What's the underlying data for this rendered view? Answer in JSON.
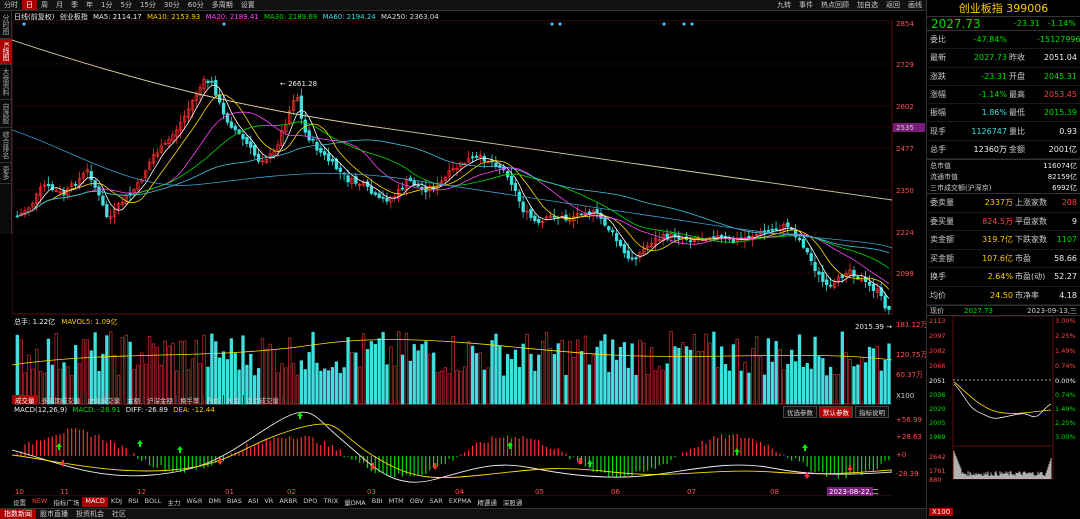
{
  "toolbar": {
    "items": [
      "分时",
      "日",
      "周",
      "月",
      "季",
      "年",
      "1分",
      "5分",
      "15分",
      "30分",
      "60分",
      "多周期",
      "设置"
    ],
    "active_index": 1,
    "right_items": [
      "九转",
      "事件",
      "热点回顾",
      "加自选",
      "返回",
      "画线"
    ]
  },
  "left_tabs": [
    "分时图",
    "K线图",
    "大盘资料",
    "自选股",
    "综合排名",
    "更多"
  ],
  "left_tabs_active": 1,
  "kline_legend": {
    "label": "日线(前复权)",
    "name": "创业板指",
    "ma5": "MA5: 2114.17",
    "ma10": "MA10: 2153.93",
    "ma20": "MA20: 2189.41",
    "ma30": "MA30: 2189.69",
    "ma60": "MA60: 2194.24",
    "ma250": "MA250: 2363.04"
  },
  "price_axis": [
    "2854",
    "2729",
    "2602",
    "2535",
    "2477",
    "2350",
    "2224",
    "2099"
  ],
  "annotations": {
    "high": "2661.28",
    "low": "2015.39"
  },
  "vol_legend": {
    "label": "总手: 1.22亿",
    "mavol": "MAVOL5: 1.09亿"
  },
  "vol_axis": [
    "181.12万",
    "120.75万",
    "60.37万",
    "X100"
  ],
  "vol_tabs": [
    "成交量",
    "多周期成交量",
    "虚拟成交量",
    "金额",
    "沪深金额",
    "换手率",
    "内盘",
    "外盘",
    "盘后成交量"
  ],
  "macd_legend": {
    "label": "MACD(12,26,9)",
    "macd": "MACD: -28.91",
    "diff": "DIFF: -26.89",
    "dea": "DEA: -12.44"
  },
  "macd_buttons": [
    "优选参数",
    "默认参数",
    "指标说明"
  ],
  "macd_axis": [
    "+56.99",
    "+28.63",
    "+0",
    "-28.39"
  ],
  "x_axis": [
    "10",
    "11",
    "12",
    "01",
    "02",
    "03",
    "04",
    "05",
    "06",
    "07",
    "08"
  ],
  "date_badge": "2023-08-22,二",
  "indicator_tabs": [
    "设置",
    "NEW",
    "指标广场",
    "MACD",
    "KDJ",
    "RSI",
    "BOLL",
    "主力",
    "W&R",
    "DMI",
    "BIAS",
    "ASI",
    "VR",
    "ARBR",
    "DPO",
    "TRIX",
    "量DMA",
    "BBI",
    "MTM",
    "OBV",
    "SAR",
    "EXPMA",
    "精選通",
    "深股通"
  ],
  "bottom_tabs": [
    "指数新闻",
    "股市直播",
    "投资机会",
    "社区"
  ],
  "side": {
    "title": "创业板指 399006",
    "price": "2027.73",
    "change": "-23.31",
    "pct": "-1.14%",
    "rows": [
      {
        "l1": "委比",
        "v1": "-47.84%",
        "l2": "",
        "v2": "-15127996"
      },
      {
        "l1": "最新",
        "v1": "2027.73",
        "l2": "昨收",
        "v2": "2051.04"
      },
      {
        "l1": "涨跌",
        "v1": "-23.31",
        "l2": "开盘",
        "v2": "2045.31"
      },
      {
        "l1": "涨幅",
        "v1": "-1.14%",
        "l2": "最高",
        "v2": "2053.45"
      },
      {
        "l1": "振幅",
        "v1": "1.86%",
        "l2": "最低",
        "v2": "2015.39"
      },
      {
        "l1": "现手",
        "v1": "1126747",
        "l2": "量比",
        "v2": "0.93"
      },
      {
        "l1": "总手",
        "v1": "12360万",
        "l2": "金额",
        "v2": "2001亿"
      }
    ],
    "mkt": [
      {
        "l": "总市值",
        "v": "116074亿"
      },
      {
        "l": "流通市值",
        "v": "82159亿"
      },
      {
        "l": "三市成交额(沪深京)",
        "v": "6992亿"
      }
    ],
    "rows2": [
      {
        "l1": "委卖量",
        "v1": "2337万",
        "l2": "上涨家数",
        "v2": "208"
      },
      {
        "l1": "委买量",
        "v1": "824.5万",
        "l2": "平盘家数",
        "v2": "9"
      },
      {
        "l1": "卖金额",
        "v1": "319.7亿",
        "l2": "下跌家数",
        "v2": "1107"
      },
      {
        "l1": "买金额",
        "v1": "107.6亿",
        "l2": "市盈",
        "v2": "58.66"
      },
      {
        "l1": "换手",
        "v1": "2.64%",
        "l2": "市盈(动)",
        "v2": "52.27"
      },
      {
        "l1": "均价",
        "v1": "24.50",
        "l2": "市净率",
        "v2": "4.18"
      }
    ],
    "now_label": "现价",
    "now_value": "2027.73",
    "now_date": "2023-09-13,三",
    "mini_left": [
      "2113",
      "2097",
      "2082",
      "2066",
      "2051",
      "2036",
      "2020",
      "2005",
      "1989",
      "2642",
      "1761",
      "880"
    ],
    "mini_right": [
      "3.00%",
      "2.25%",
      "1.49%",
      "0.74%",
      "0.00%",
      "0.74%",
      "1.49%",
      "2.25%",
      "3.00%"
    ],
    "mini_tab": "X100"
  }
}
